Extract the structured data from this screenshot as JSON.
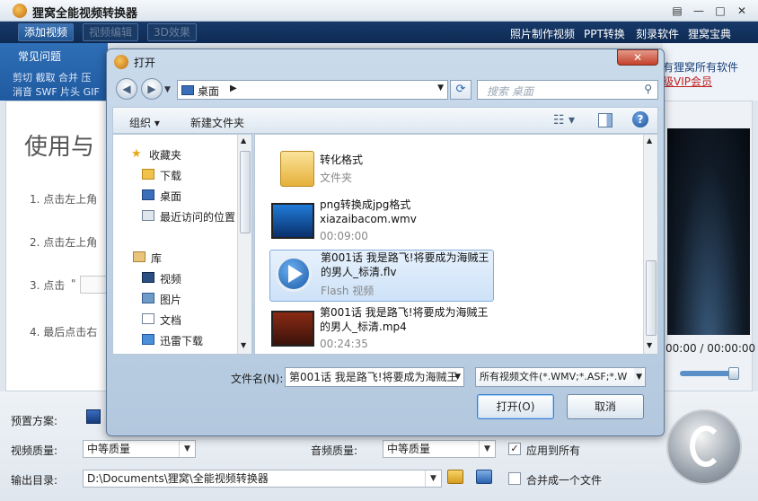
{
  "app": {
    "title": "狸窝全能视频转换器",
    "window_controls": [
      "▤",
      "—",
      "□",
      "✕"
    ]
  },
  "toolbar": {
    "add_video": "添加视频",
    "video_edit": "视频编辑",
    "effect_3d": "3D效果",
    "links": [
      "照片制作视频",
      "PPT转换",
      "刻录软件",
      "狸窝宝典"
    ]
  },
  "left_panel": {
    "heading": "常见问题",
    "line1": "剪切 截取 合并 压",
    "line2": "消音 SWF 片头 GIF"
  },
  "right_strip": {
    "line1": "有狸窝所有软件",
    "line2": "级VIP会员"
  },
  "guide": {
    "title": "使用与",
    "steps": [
      "1. 点击左上角",
      "2. 点击左上角",
      "3. 点击",
      "4. 最后点击右"
    ],
    "step3_quote": "\""
  },
  "player": {
    "time": "00:00 / 00:00:00"
  },
  "bottom": {
    "preset_label": "预置方案:",
    "video_quality_label": "视频质量:",
    "video_quality_value": "中等质量",
    "audio_quality_label": "音频质量:",
    "audio_quality_value": "中等质量",
    "apply_all": "应用到所有",
    "apply_all_checked": "✓",
    "output_label": "输出目录:",
    "output_path": "D:\\Documents\\狸窝\\全能视频转换器",
    "merge_label": "合并成一个文件"
  },
  "dialog": {
    "title": "打开",
    "close": "✕",
    "address": "桌面",
    "address_sep": "▶",
    "search_placeholder": "搜索 桌面",
    "organize": "组织 ▾",
    "new_folder": "新建文件夹",
    "view_icon": "☷ ▾",
    "help": "?",
    "nav": {
      "favorites": "收藏夹",
      "favorites_items": [
        "下载",
        "桌面",
        "最近访问的位置"
      ],
      "library": "库",
      "library_items": [
        "视频",
        "图片",
        "文档",
        "迅雷下载"
      ]
    },
    "files": [
      {
        "name1": "转化格式",
        "name2": "",
        "meta": "文件夹"
      },
      {
        "name1": "png转换成jpg格式",
        "name2": "xiazaibacom.wmv",
        "meta": "00:09:00"
      },
      {
        "name1": "第001话 我是路飞!将要成为海贼王",
        "name2": "的男人_标清.flv",
        "meta": "Flash 视频"
      },
      {
        "name1": "第001话 我是路飞!将要成为海贼王",
        "name2": "的男人_标清.mp4",
        "meta": "00:24:35"
      }
    ],
    "filename_label": "文件名(N):",
    "filename_value": "第001话 我是路飞!将要成为海贼王",
    "filetype_value": "所有视频文件(*.WMV;*.ASF;*.W",
    "open_button": "打开(O)",
    "cancel_button": "取消"
  },
  "colors": {
    "toolbar_bg": "#173a6b",
    "accent": "#2f6fb6",
    "selection": "#cde2f8"
  }
}
